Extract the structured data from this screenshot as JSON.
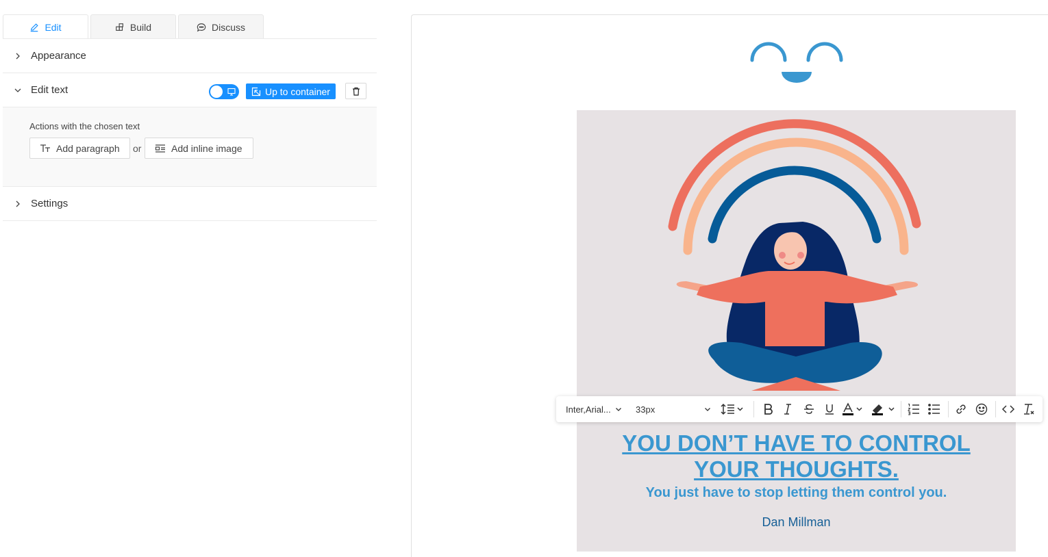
{
  "tabs": [
    {
      "label": "Edit",
      "icon": "pencil-icon",
      "active": true
    },
    {
      "label": "Build",
      "icon": "blocks-icon",
      "active": false
    },
    {
      "label": "Discuss",
      "icon": "chat-icon",
      "active": false
    }
  ],
  "sections": {
    "appearance": {
      "label": "Appearance",
      "expanded": false
    },
    "edit_text": {
      "label": "Edit text",
      "expanded": true,
      "up_to_container": "Up to container",
      "actions_label": "Actions with the chosen text",
      "add_paragraph": "Add paragraph",
      "or": "or",
      "add_inline_image": "Add inline image"
    },
    "settings": {
      "label": "Settings",
      "expanded": false
    }
  },
  "toolbar": {
    "font": "Inter,Arial...",
    "size": "33px",
    "buttons": [
      "line-height-icon",
      "bold-icon",
      "italic-icon",
      "strikethrough-icon",
      "underline-icon",
      "text-color-icon",
      "highlight-icon",
      "ordered-list-icon",
      "bullet-list-icon",
      "link-icon",
      "emoji-icon",
      "code-icon",
      "clear-format-icon"
    ]
  },
  "content": {
    "title_line1": "YOU DON’T HAVE TO CONTROL",
    "title_line2": "YOUR THOUGHTS.",
    "subtitle": "You just have to stop letting them control you.",
    "author": "Dan Millman"
  },
  "colors": {
    "accent": "#1890ff",
    "quote_blue": "#3a97d0",
    "author_blue": "#165f96",
    "content_bg": "#e7e2e4"
  }
}
